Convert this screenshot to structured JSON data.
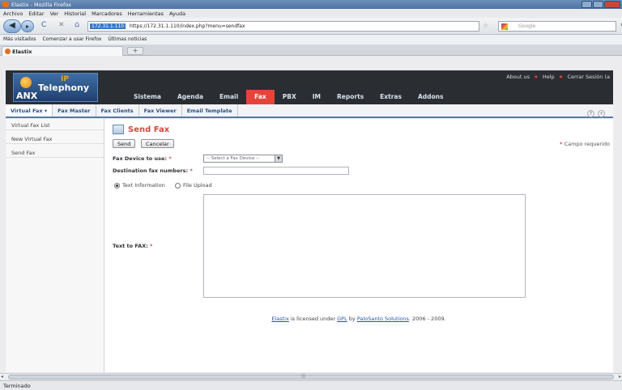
{
  "window": {
    "title": "Elastix - Mozilla Firefox"
  },
  "menubar": [
    "Archivo",
    "Editar",
    "Ver",
    "Historial",
    "Marcadores",
    "Herramientas",
    "Ayuda"
  ],
  "navbar": {
    "url_ip": "172.31.1.110",
    "url": "https://172.31.1.110/index.php?menu=sendfax",
    "search_placeholder": "Google"
  },
  "bookmarks": [
    "Más visitados",
    "Comenzar a usar Firefox",
    "Últimas noticias"
  ],
  "tab": {
    "title": "Elastix",
    "new_tab": "+"
  },
  "app": {
    "logo": {
      "anx": "ANX",
      "ip": "IP",
      "telephony": "Telephony"
    },
    "top_links": [
      "About us",
      "Help",
      "Cerrar Sesión (a"
    ],
    "top_sep": "★",
    "main_nav": [
      "Sistema",
      "Agenda",
      "Email",
      "Fax",
      "PBX",
      "IM",
      "Reports",
      "Extras",
      "Addons"
    ],
    "sub_nav": [
      "Virtual Fax ▾",
      "Fax Master",
      "Fax Clients",
      "Fax Viewer",
      "Email Template"
    ],
    "sub_nav_opts": [
      "?",
      "+"
    ],
    "sidebar": [
      "Virtual Fax List",
      "New Virtual Fax",
      "Send Fax"
    ]
  },
  "form": {
    "title": "Send Fax",
    "send_label": "Send",
    "cancel_label": "Cancelar",
    "required_note": "Campo requerido",
    "asterisk": "*",
    "device_label": "Fax Device to use:",
    "device_value": "-- Select a Fax Device --",
    "numbers_label": "Destination fax numbers:",
    "numbers_value": "",
    "radio_text": "Text Information",
    "radio_file": "File Upload",
    "text_label": "Text to FAX:",
    "text_value": ""
  },
  "footer": {
    "link1": "Elastix",
    "t1": " is licensed under ",
    "link2": "GPL",
    "t2": " by ",
    "link3": "PaloSanto Solutions",
    "t3": ". 2006 - 2009."
  },
  "status": "Terminado"
}
